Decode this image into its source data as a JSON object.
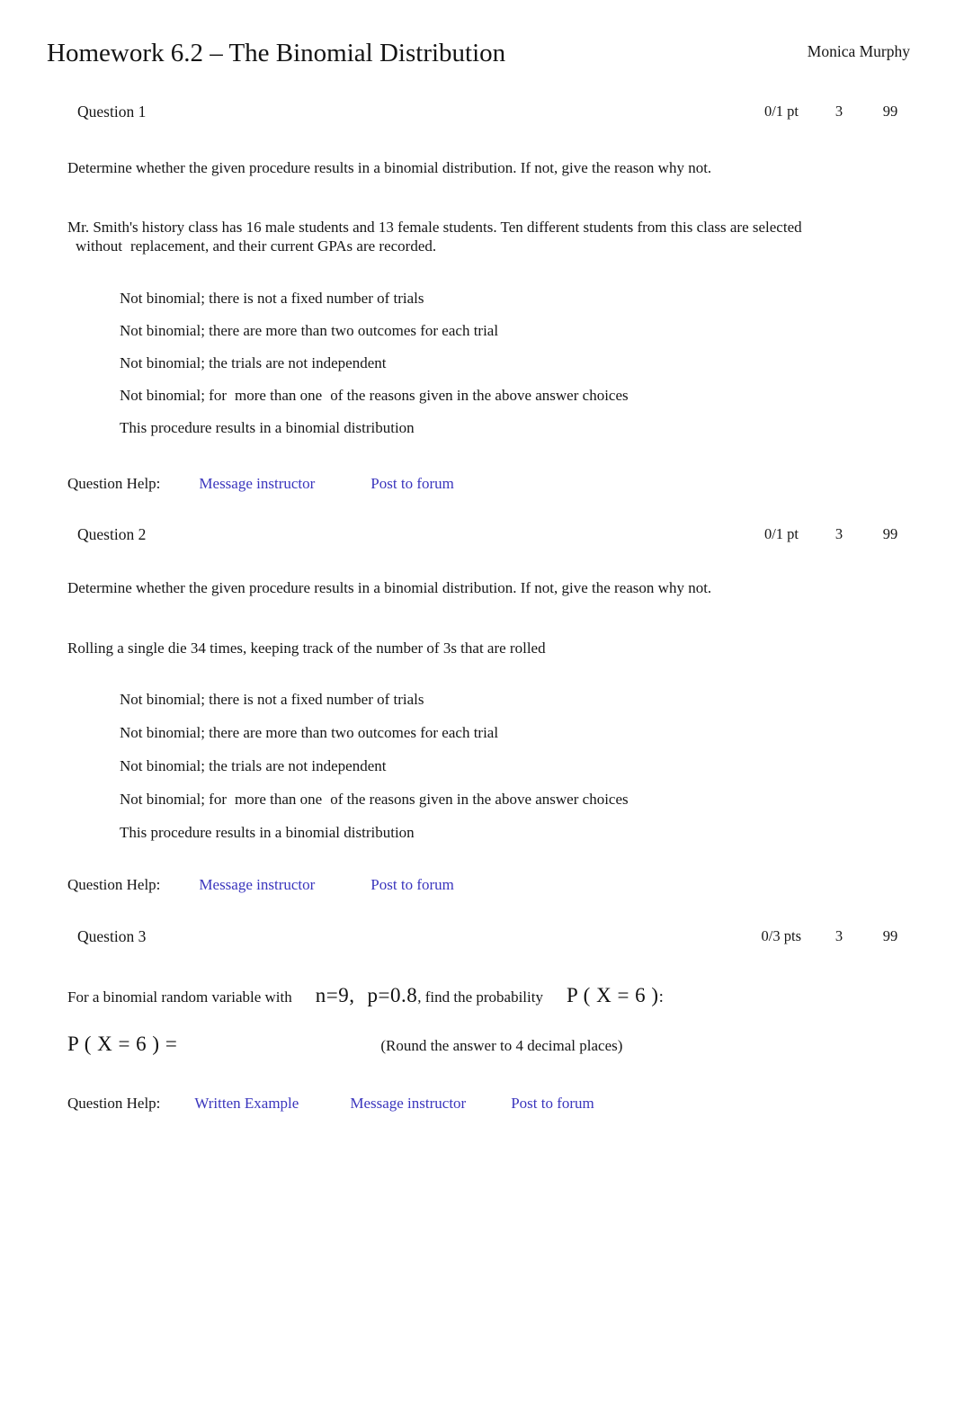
{
  "header": {
    "title": "Homework 6.2 – The Binomial Distribution",
    "student_name": "Monica Murphy"
  },
  "help_labels": {
    "question_help": "Question Help:",
    "written_example": "Written Example",
    "message_instructor": "Message instructor",
    "post_to_forum": "Post to forum"
  },
  "colors": {
    "link": "#3a35bd",
    "text": "#161616",
    "background": "#ffffff"
  },
  "questions": [
    {
      "label": "Question 1",
      "points": "0/1 pt",
      "attempts": "3",
      "details": "99",
      "prompt_1": "Determine whether the given procedure results in a binomial distribution. If not, give the reason why not.",
      "prompt_2_a": "Mr. Smith's history class has 16 male students and 13 female students. Ten different students from this class are selected",
      "prompt_2_emph": "without",
      "prompt_2_b": "replacement, and their current GPAs are recorded.",
      "choices": [
        "Not binomial; there is not a fixed number of trials",
        "Not binomial; there are more than two outcomes for each trial",
        "Not binomial; the trials are not independent",
        "This procedure results in a binomial distribution"
      ],
      "choice_split": {
        "before": "Not binomial; for",
        "emph": "more than one",
        "after": "of the reasons given in the above answer choices"
      },
      "help_links": [
        "Message instructor",
        "Post to forum"
      ]
    },
    {
      "label": "Question 2",
      "points": "0/1 pt",
      "attempts": "3",
      "details": "99",
      "prompt_1": "Determine whether the given procedure results in a binomial distribution. If not, give the reason why not.",
      "prompt_2": "Rolling a single die 34 times, keeping track of the number of 3s that are rolled",
      "choices": [
        "Not binomial; there is not a fixed number of trials",
        "Not binomial; there are more than two outcomes for each trial",
        "Not binomial; the trials are not independent",
        "This procedure results in a binomial distribution"
      ],
      "choice_split": {
        "before": "Not binomial; for",
        "emph": "more than one",
        "after": "of the reasons given in the above answer choices"
      },
      "help_links": [
        "Message instructor",
        "Post to forum"
      ]
    },
    {
      "label": "Question 3",
      "points": "0/3 pts",
      "attempts": "3",
      "details": "99",
      "stem_before": "For a binomial random variable with",
      "math_n": "n",
      "math_eq1": "=",
      "math_n_val": "9,",
      "math_p": "p",
      "math_eq2": "=",
      "math_p_val": "0.8",
      "stem_middle": ", find the probability",
      "math_prob": "P ( X  =  6 )",
      "stem_colon": ":",
      "answer_math": "P ( X  =  6 )  =",
      "answer_value": "",
      "round_note": "(Round the answer to 4 decimal places)",
      "help_links": [
        "Written Example",
        "Message instructor",
        "Post to forum"
      ]
    }
  ]
}
